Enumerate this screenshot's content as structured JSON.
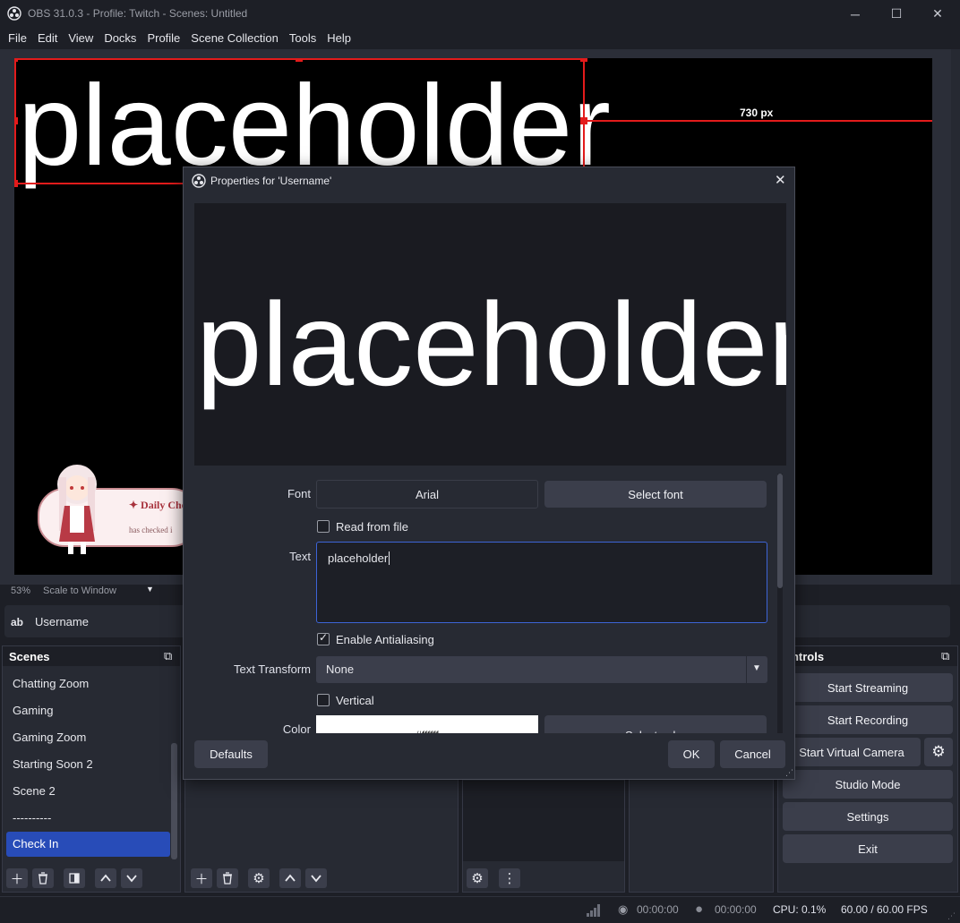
{
  "window": {
    "title": "OBS 31.0.3 - Profile: Twitch - Scenes: Untitled",
    "minimize": "─",
    "maximize": "☐",
    "close": "✕"
  },
  "menu": [
    "File",
    "Edit",
    "View",
    "Docks",
    "Profile",
    "Scene Collection",
    "Tools",
    "Help"
  ],
  "preview": {
    "text": "placeholder",
    "measure_label": "730 px",
    "overlay_title": "✦ Daily Che",
    "overlay_sub": "has checked i"
  },
  "zoombar": {
    "zoom": "53%",
    "mode": "Scale to Window"
  },
  "source_row": {
    "icon_text": "ab",
    "name": "Username"
  },
  "scenes": {
    "title": "Scenes",
    "items": [
      "Chatting Zoom",
      "Gaming",
      "Gaming Zoom",
      "Starting Soon 2",
      "Scene 2",
      "----------",
      "Check In"
    ],
    "active_index": 6
  },
  "controls": {
    "title": "ontrols",
    "buttons": [
      "Start Streaming",
      "Start Recording",
      "Start Virtual Camera",
      "Studio Mode",
      "Settings",
      "Exit"
    ]
  },
  "statusbar": {
    "stream_time": "00:00:00",
    "record_time": "00:00:00",
    "cpu": "CPU: 0.1%",
    "fps": "60.00 / 60.00 FPS"
  },
  "dialog": {
    "title": "Properties for 'Username'",
    "preview_text": "placeholder",
    "font_label": "Font",
    "font_value": "Arial",
    "select_font": "Select font",
    "read_from_file": "Read from file",
    "text_label": "Text",
    "text_value": "placeholder",
    "antialias": "Enable Antialiasing",
    "transform_label": "Text Transform",
    "transform_value": "None",
    "vertical": "Vertical",
    "color_label": "Color",
    "color_value": "#ffffff",
    "select_color": "Select color",
    "defaults": "Defaults",
    "ok": "OK",
    "cancel": "Cancel"
  },
  "colors": {
    "accent": "#284cb8",
    "selection": "#e31b1b",
    "background": "#1d1f26",
    "dock": "#272a33",
    "button": "#3b3e4b"
  }
}
